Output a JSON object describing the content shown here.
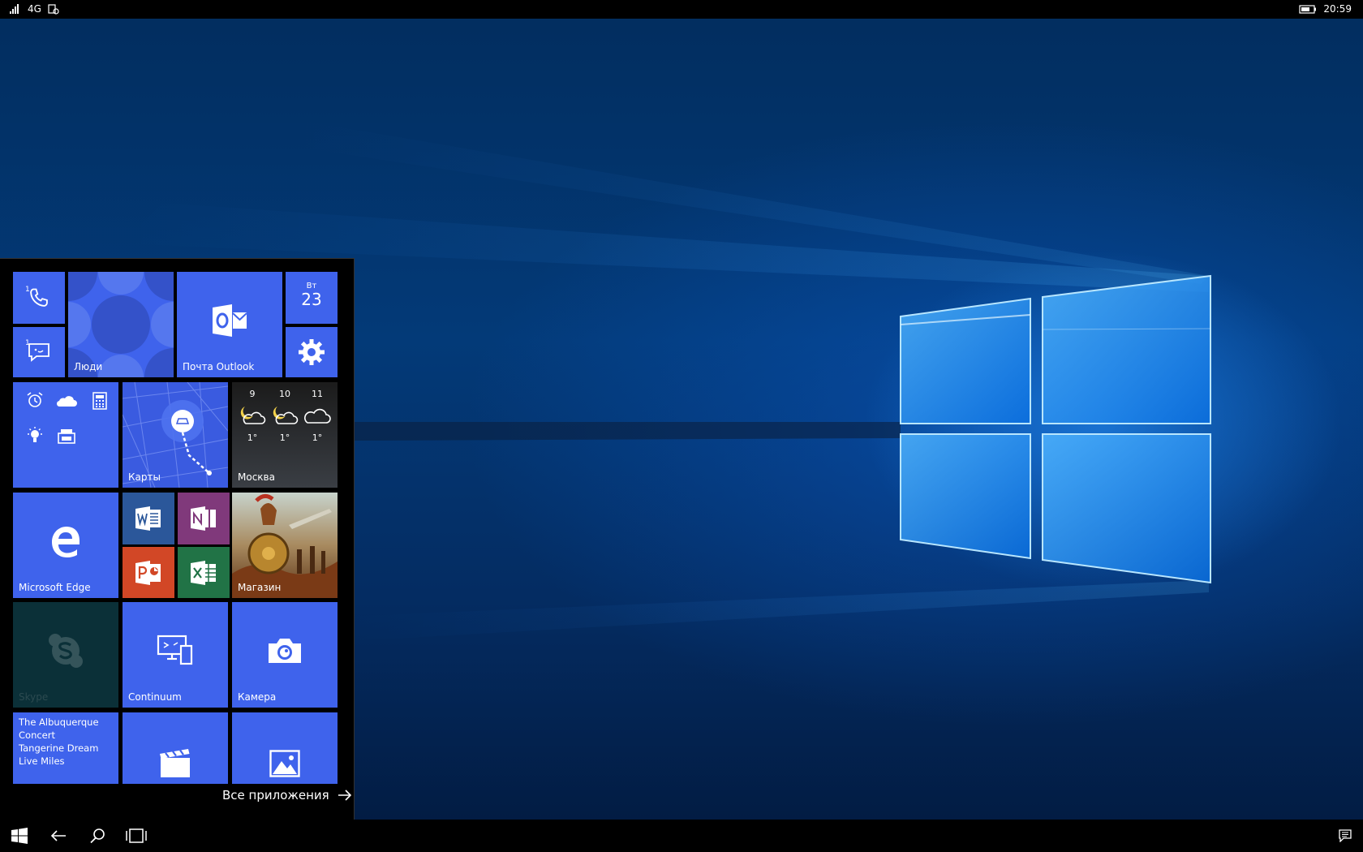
{
  "statusbar": {
    "network": "4G",
    "time": "20:59"
  },
  "tiles": {
    "phone_badge": "1",
    "messaging_badge": "1",
    "people_label": "Люди",
    "outlook_label": "Почта Outlook",
    "calendar_day": "Вт",
    "calendar_date": "23",
    "maps_label": "Карты",
    "weather": {
      "city": "Москва",
      "forecast": [
        {
          "hour": "9",
          "temp": "1°"
        },
        {
          "hour": "10",
          "temp": "1°"
        },
        {
          "hour": "11",
          "temp": "1°"
        }
      ]
    },
    "edge_label": "Microsoft Edge",
    "store_label": "Магазин",
    "skype_label": "Skype",
    "continuum_label": "Continuum",
    "camera_label": "Камера",
    "music_lines": [
      "The Albuquerque",
      "Concert",
      "Tangerine Dream",
      "Live Miles"
    ]
  },
  "all_apps_label": "Все приложения",
  "colors": {
    "accent": "#3f63ec",
    "word": "#2b579a",
    "onenote": "#80397b",
    "powerpoint": "#d24726",
    "excel": "#217346",
    "skype_dark": "#0b3038"
  }
}
